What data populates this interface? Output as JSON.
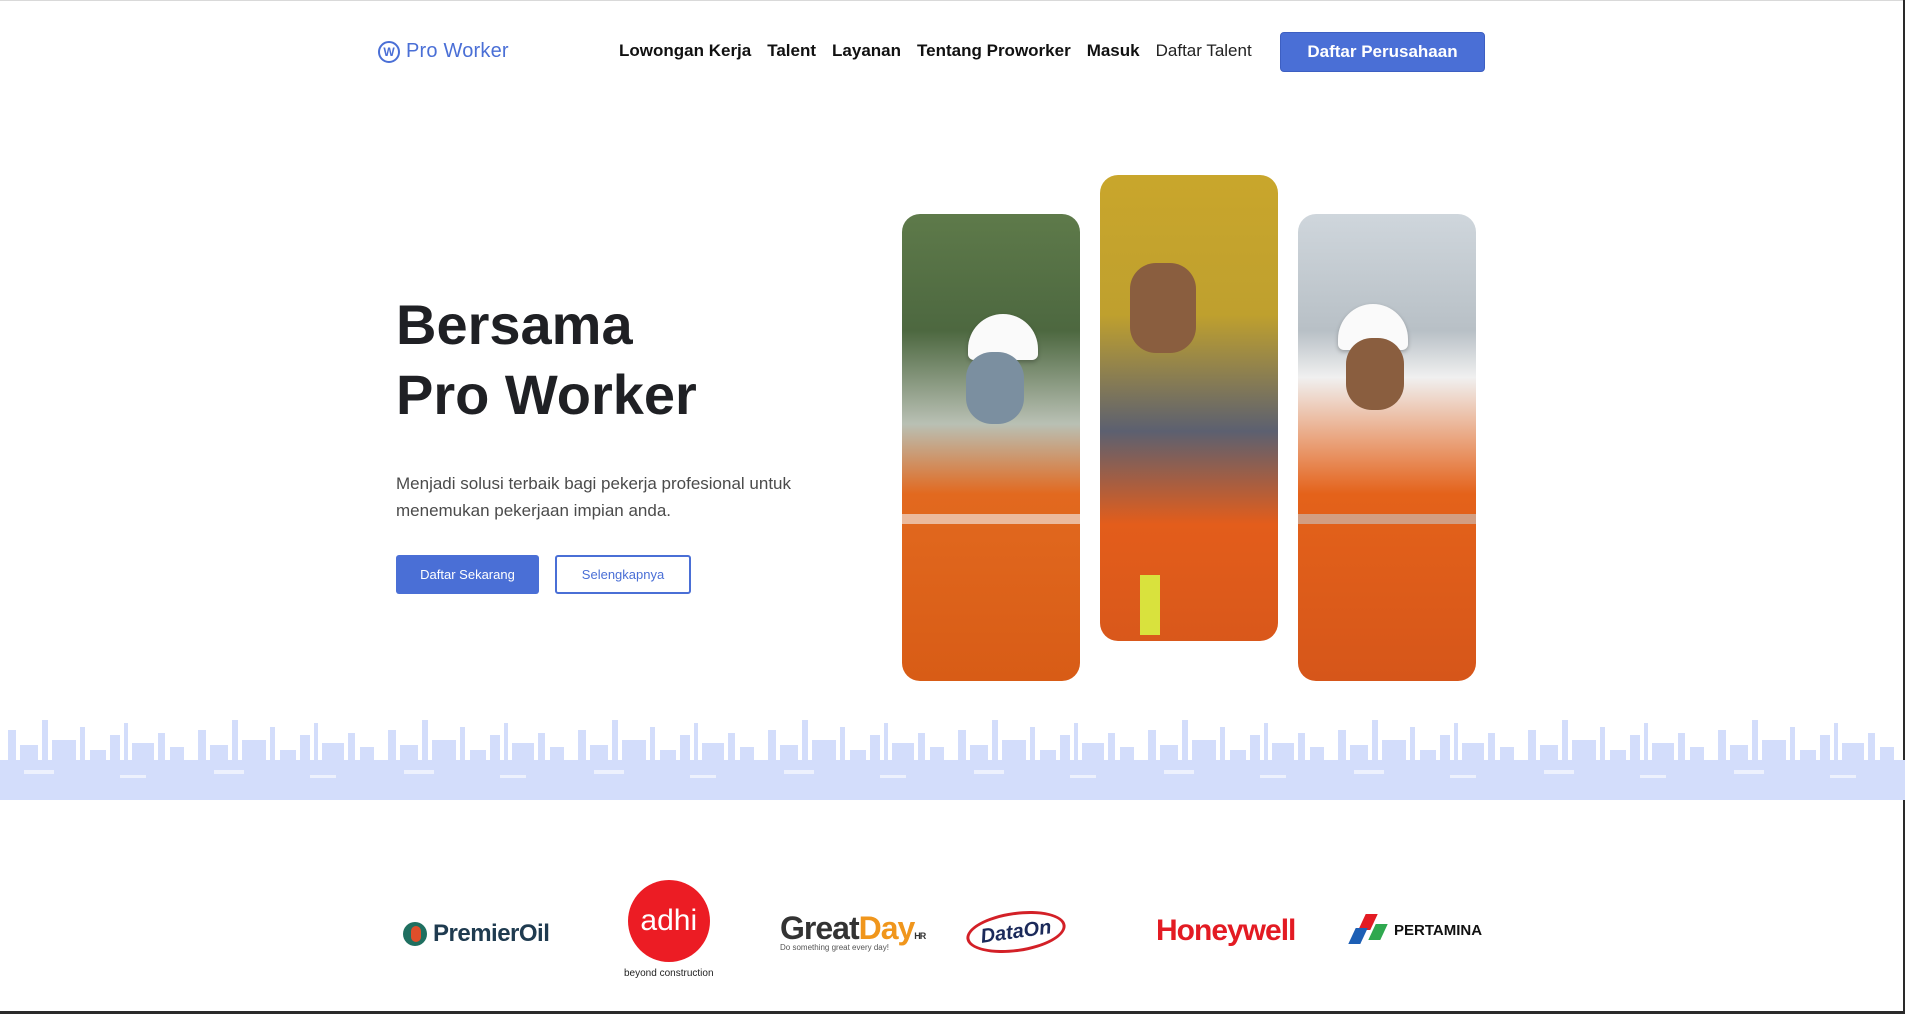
{
  "header": {
    "logo_text": "Pro Worker",
    "logo_mark": "W",
    "nav": [
      {
        "label": "Lowongan Kerja"
      },
      {
        "label": "Talent"
      },
      {
        "label": "Layanan"
      },
      {
        "label": "Tentang Proworker"
      },
      {
        "label": "Masuk"
      },
      {
        "label": "Daftar Talent"
      }
    ],
    "cta_label": "Daftar Perusahaan"
  },
  "hero": {
    "title_line1": "Bersama",
    "title_line2": "Pro Worker",
    "description": "Menjadi solusi terbaik bagi pekerja profesional untuk menemukan pekerjaan impian anda.",
    "primary_button": "Daftar Sekarang",
    "secondary_button": "Selengkapnya"
  },
  "partners": {
    "premier": "PremierOil",
    "adhi": "adhi",
    "adhi_tagline": "beyond construction",
    "greatday_great": "Great",
    "greatday_day": "Day",
    "greatday_hr": "HR",
    "greatday_tagline": "Do something great every day!",
    "dataon": "DataOn",
    "honeywell": "Honeywell",
    "pertamina": "PERTAMINA"
  },
  "colors": {
    "accent": "#4a6fd6",
    "skyline": "#d3ddfb"
  }
}
